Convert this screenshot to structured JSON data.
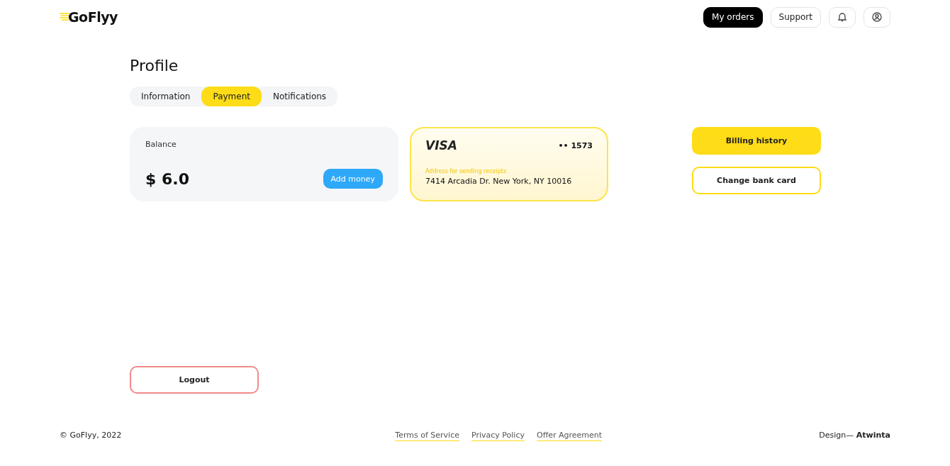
{
  "header": {
    "logo": "GoFlyy",
    "nav": [
      {
        "label": "My orders",
        "selected": true
      },
      {
        "label": "Support",
        "selected": false
      }
    ]
  },
  "title": "Profile",
  "tabs": [
    {
      "label": "Information",
      "selected": false
    },
    {
      "label": "Payment",
      "selected": true
    },
    {
      "label": "Notifications",
      "selected": false
    }
  ],
  "balance": {
    "label": "Balance",
    "amount": "$ 6.0",
    "button": "Add money"
  },
  "card": {
    "brand": "VISA",
    "number": "•• 1573",
    "address_label": "Address for sending receipts",
    "address": "7414 Arcadia Dr. New York, NY 10016"
  },
  "actions": [
    {
      "label": "Billing history",
      "kind": "primary"
    },
    {
      "label": "Change bank card",
      "kind": "outline"
    }
  ],
  "logout": "Logout",
  "footer": {
    "copyright": "© GoFlyy, 2022",
    "links": [
      "Terms of Service",
      "Privacy Policy",
      "Offer Agreement"
    ],
    "credit": "Design— **Atwinta**"
  }
}
